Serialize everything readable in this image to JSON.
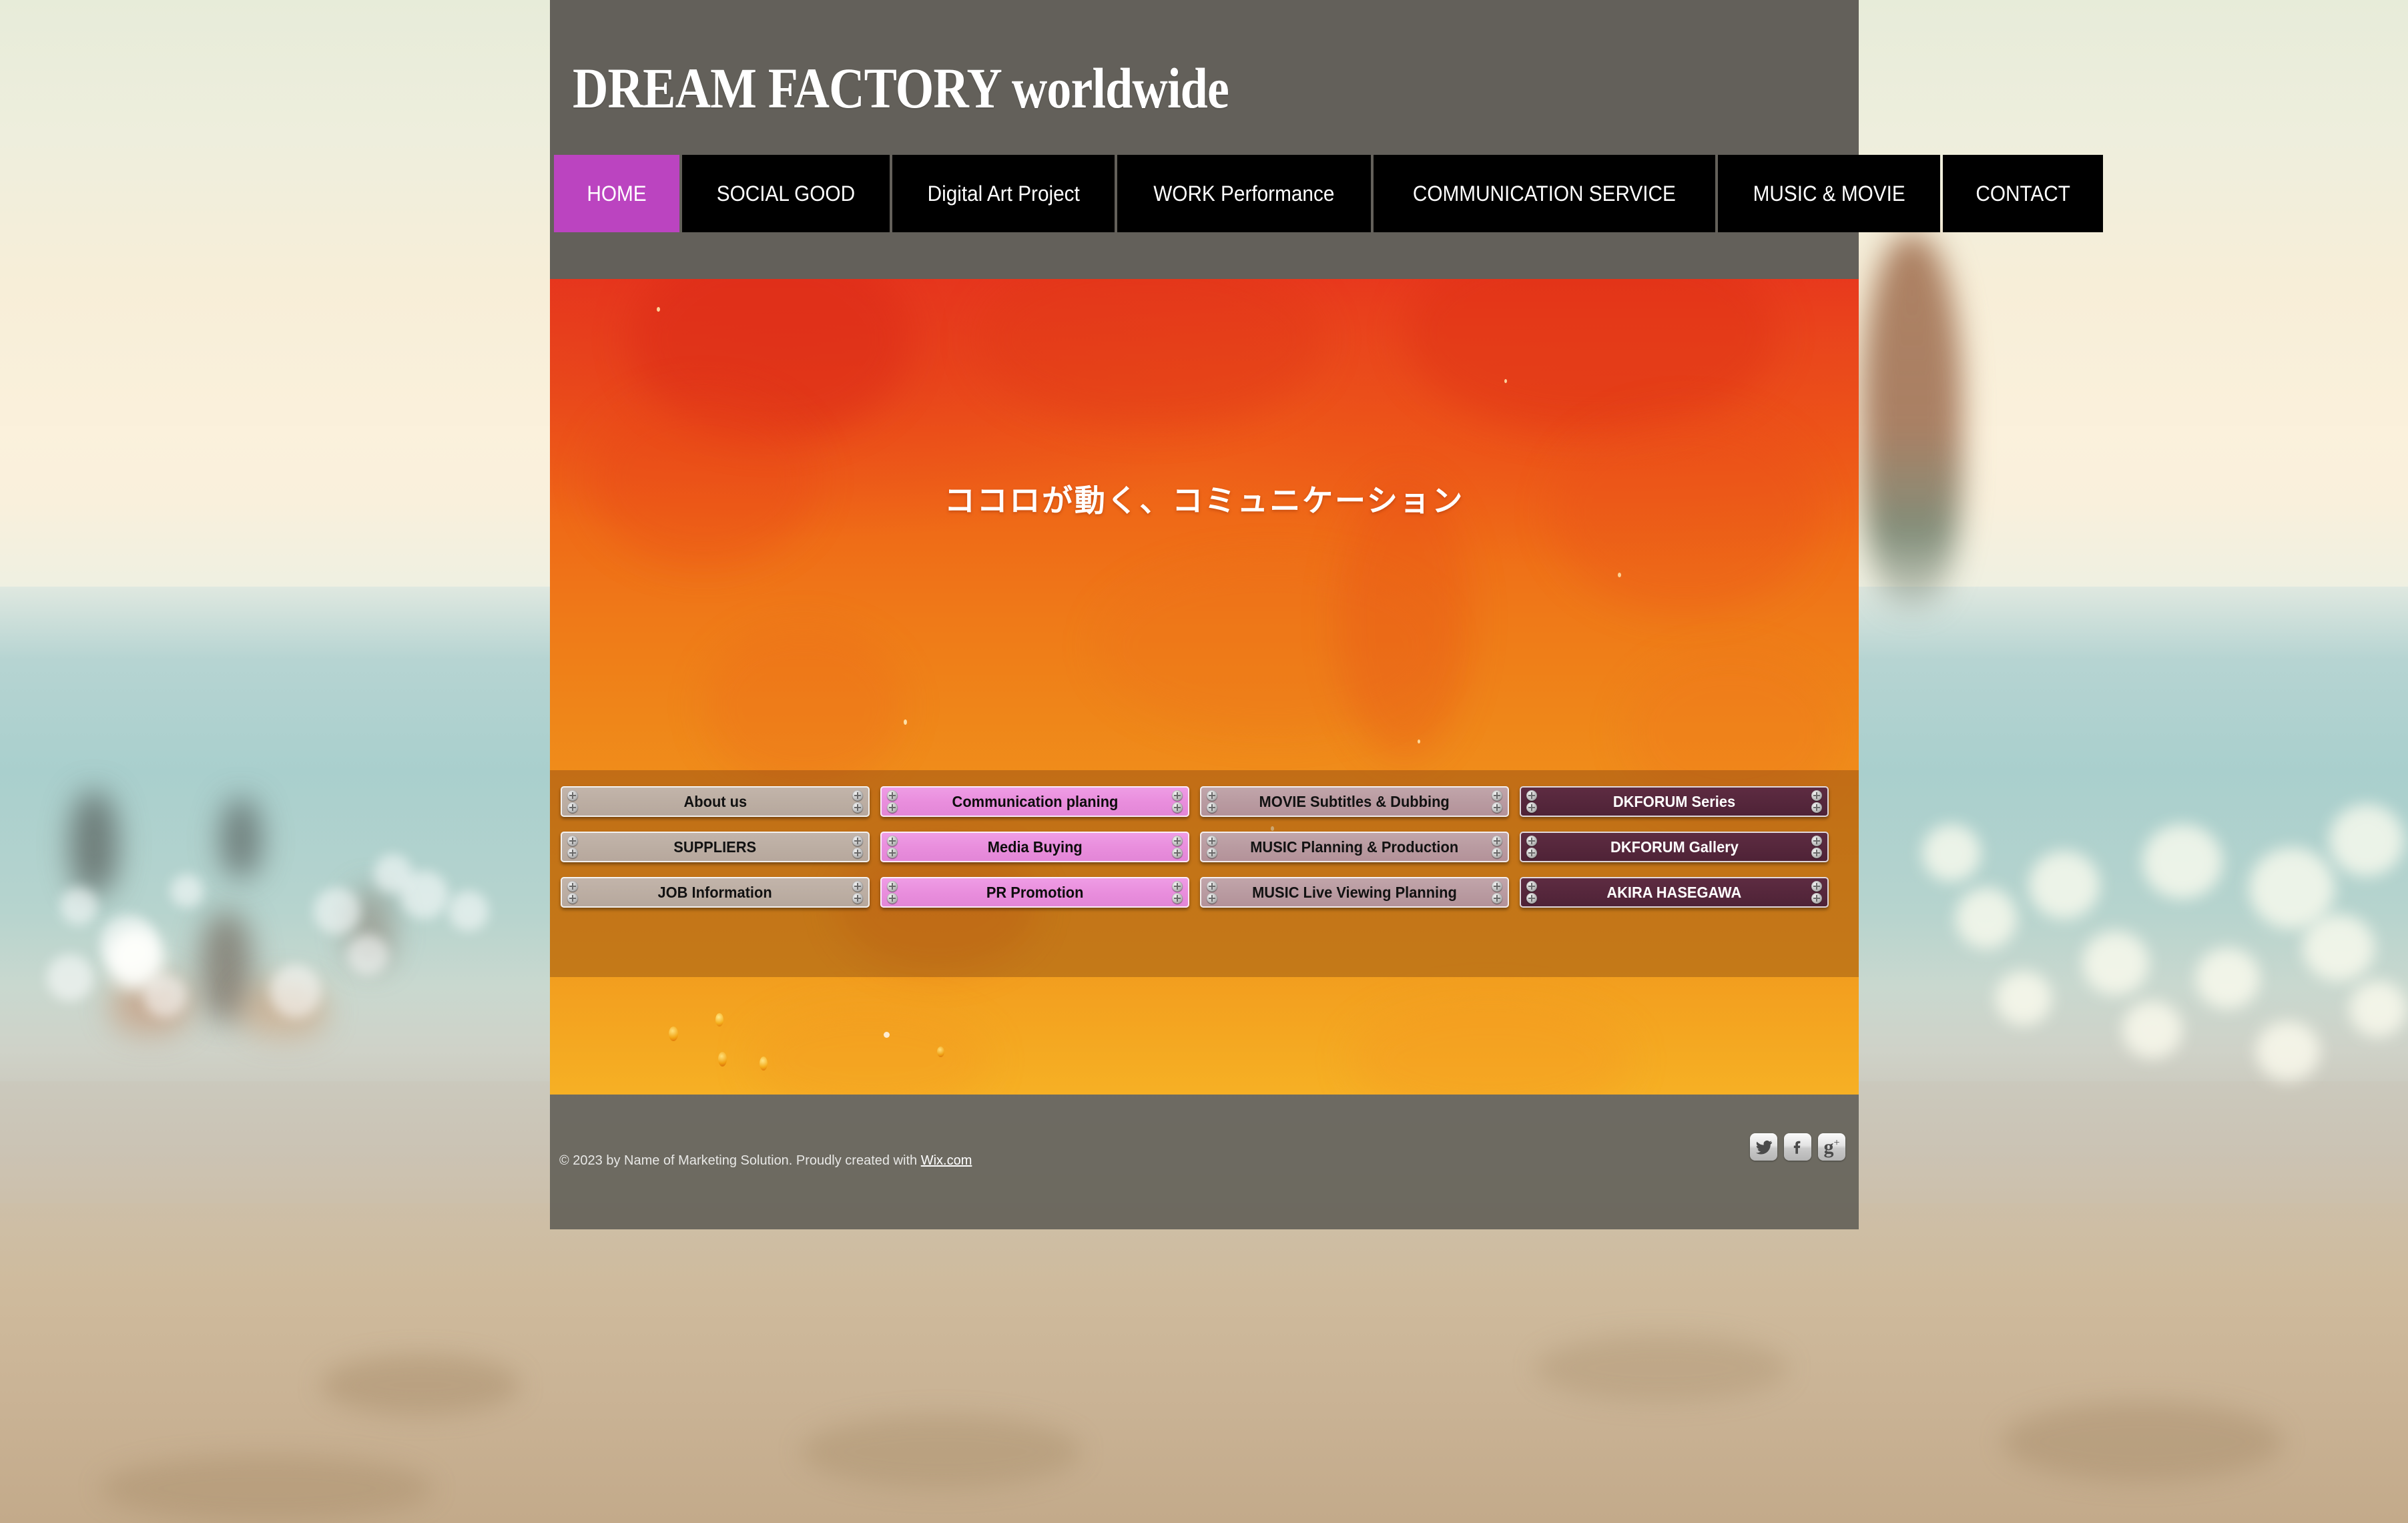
{
  "site": {
    "title": "DREAM FACTORY worldwide"
  },
  "nav": {
    "items": [
      {
        "label": "HOME",
        "active": true
      },
      {
        "label": "SOCIAL GOOD",
        "active": false
      },
      {
        "label": "Digital Art Project",
        "active": false
      },
      {
        "label": "WORK Performance",
        "active": false
      },
      {
        "label": "COMMUNICATION SERVICE",
        "active": false
      },
      {
        "label": "MUSIC & MOVIE",
        "active": false
      },
      {
        "label": "CONTACT",
        "active": false
      }
    ]
  },
  "banner": {
    "headline": "ココロが動く、コミュニケーション"
  },
  "buttons": {
    "columns": [
      {
        "style": "c1",
        "items": [
          {
            "label": "About us"
          },
          {
            "label": "SUPPLIERS"
          },
          {
            "label": "JOB Information"
          }
        ]
      },
      {
        "style": "c2",
        "items": [
          {
            "label": "Communication planing"
          },
          {
            "label": "Media Buying"
          },
          {
            "label": "PR Promotion"
          }
        ]
      },
      {
        "style": "c3",
        "items": [
          {
            "label": "MOVIE Subtitles & Dubbing"
          },
          {
            "label": "MUSIC Planning & Production"
          },
          {
            "label": "MUSIC Live Viewing Planning"
          }
        ]
      },
      {
        "style": "c4",
        "items": [
          {
            "label": "DKFORUM Series"
          },
          {
            "label": "DKFORUM Gallery"
          },
          {
            "label": "AKIRA HASEGAWA"
          }
        ]
      }
    ]
  },
  "footer": {
    "copyright_prefix": "© 2023 by Name of Marketing Solution. Proudly created with ",
    "wix_link": "Wix.com",
    "social": [
      {
        "name": "twitter-icon",
        "glyph": "twitter"
      },
      {
        "name": "facebook-icon",
        "glyph": "facebook"
      },
      {
        "name": "googleplus-icon",
        "glyph": "g",
        "sup": "+"
      }
    ]
  },
  "colors": {
    "header_gray": "#63605a",
    "nav_bg": "#000000",
    "nav_active": "#bb44c0",
    "banner_top": "#e8381d",
    "banner_bottom": "#f6b024",
    "panel_overlay": "rgba(90,40,12,.30)",
    "footer_gray": "rgba(96,93,85,.88)",
    "btn_gray": "#bcaea3",
    "btn_pink": "#e98edd",
    "btn_mauve": "#b99ba1",
    "btn_plum": "#56273c"
  }
}
